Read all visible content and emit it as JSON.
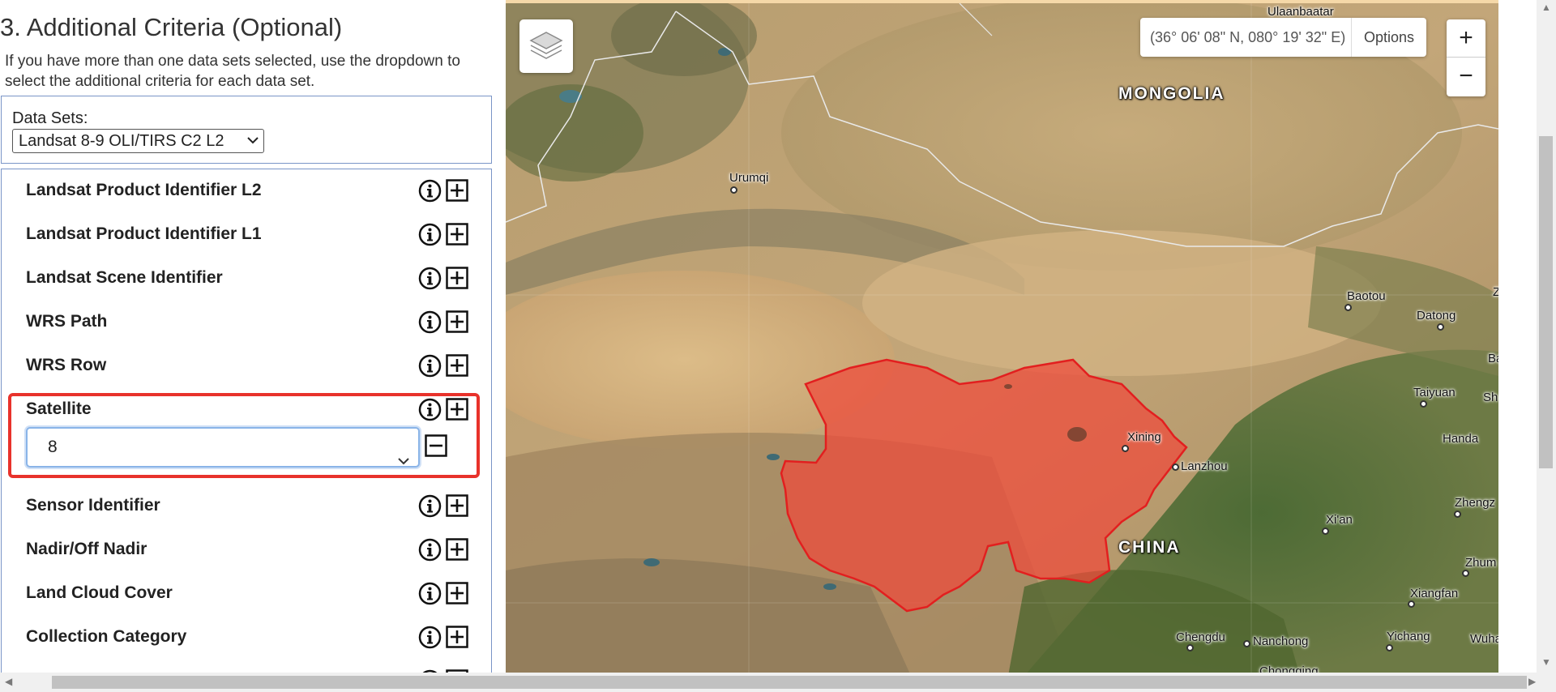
{
  "panel": {
    "title": "3. Additional Criteria (Optional)",
    "description": "If you have more than one data sets selected, use the dropdown to select the additional criteria for each data set.",
    "dataset_label": "Data Sets:",
    "dataset_selected": "Landsat 8-9 OLI/TIRS C2 L2"
  },
  "criteria": [
    {
      "label": "Landsat Product Identifier L2"
    },
    {
      "label": "Landsat Product Identifier L1"
    },
    {
      "label": "Landsat Scene Identifier"
    },
    {
      "label": "WRS Path"
    },
    {
      "label": "WRS Row"
    },
    {
      "label": "Satellite"
    },
    {
      "label": "Sensor Identifier"
    },
    {
      "label": "Nadir/Off Nadir"
    },
    {
      "label": "Land Cloud Cover"
    },
    {
      "label": "Collection Category"
    }
  ],
  "satellite": {
    "selected_value": "8"
  },
  "map": {
    "coordinates": "(36° 06' 08\" N, 080° 19' 32\" E)",
    "options_label": "Options",
    "zoom_in": "+",
    "zoom_out": "−",
    "countries": [
      "MONGOLIA",
      "CHINA"
    ],
    "cities": [
      "Ulaanbaatar",
      "Urumqi",
      "Baotou",
      "Datong",
      "Taiyuan",
      "Xining",
      "Lanzhou",
      "Xi'an",
      "Zhengz",
      "Handa",
      "Zhum",
      "Xiangfan",
      "Chengdu",
      "Nanchong",
      "Yichang",
      "Wuha",
      "Chongqing",
      "Sh",
      "Ba",
      "Z"
    ],
    "highlight_color": "#e8322b"
  },
  "colors": {
    "panel_border": "#7a95c7",
    "selection_border": "#e8322b",
    "focus_outline": "#8ab4e8"
  }
}
